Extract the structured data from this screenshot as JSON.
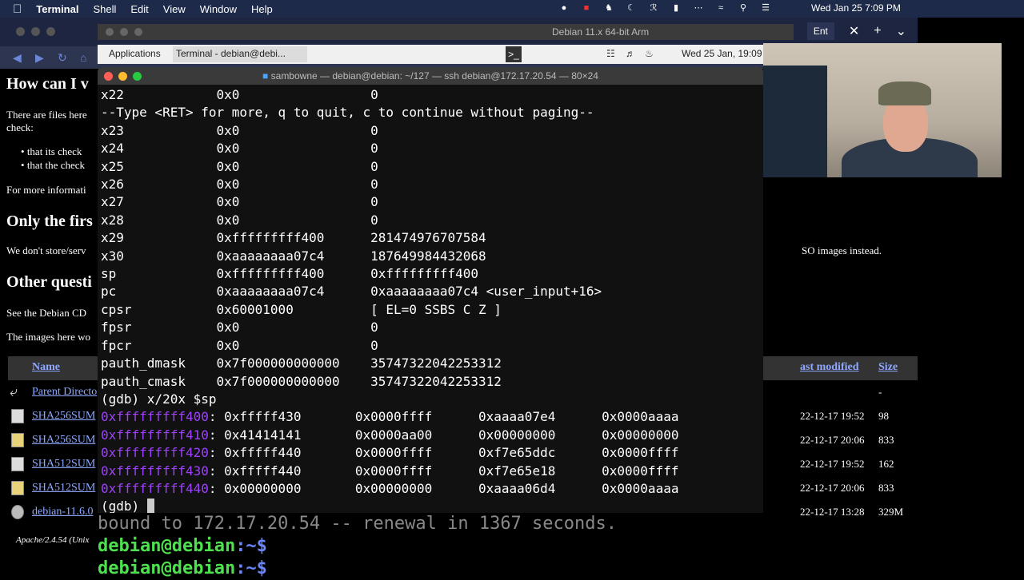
{
  "menubar": {
    "apple": "",
    "app": "Terminal",
    "items": [
      "Shell",
      "Edit",
      "View",
      "Window",
      "Help"
    ],
    "clock": "Wed Jan 25  7:09 PM"
  },
  "browser": {
    "tab_label": "Ent",
    "headings": [
      "How can I v",
      "Only the firs",
      "Other questi"
    ],
    "paragraphs": [
      "There are files here",
      "check:",
      "that its check",
      "that the check",
      "For more informati",
      "We don't store/serv",
      "SO images instead.",
      "See the Debian CD",
      "The images here wo",
      "Apache/2.4.54 (Unix"
    ],
    "table_headers": {
      "name": "Name",
      "modified": "ast modified",
      "size": "Size"
    },
    "rows": [
      {
        "name": "Parent Directo",
        "date": "",
        "size": "-"
      },
      {
        "name": "SHA256SUM",
        "date": "22-12-17 19:52",
        "size": "98"
      },
      {
        "name": "SHA256SUM",
        "date": "22-12-17 20:06",
        "size": "833"
      },
      {
        "name": "SHA512SUM",
        "date": "22-12-17 19:52",
        "size": "162"
      },
      {
        "name": "SHA512SUM",
        "date": "22-12-17 20:06",
        "size": "833"
      },
      {
        "name": "debian-11.6.0",
        "date": "22-12-17 13:28",
        "size": "329M"
      }
    ]
  },
  "vm": {
    "title": "Debian 11.x 64-bit Arm",
    "panel_apps": "Applications",
    "panel_task": "Terminal - debian@debi...",
    "panel_clock": "Wed 25 Jan, 19:09"
  },
  "terminal": {
    "title": "sambowne — debian@debian: ~/127 — ssh debian@172.17.20.54 — 80×24",
    "lines": [
      "x22            0x0                 0",
      "--Type <RET> for more, q to quit, c to continue without paging--",
      "x23            0x0                 0",
      "x24            0x0                 0",
      "x25            0x0                 0",
      "x26            0x0                 0",
      "x27            0x0                 0",
      "x28            0x0                 0",
      "x29            0xfffffffff400      281474976707584",
      "x30            0xaaaaaaaa07c4      187649984432068",
      "sp             0xfffffffff400      0xfffffffff400",
      "pc             0xaaaaaaaa07c4      0xaaaaaaaa07c4 <user_input+16>",
      "cpsr           0x60001000          [ EL=0 SSBS C Z ]",
      "fpsr           0x0                 0",
      "fpcr           0x0                 0",
      "pauth_dmask    0x7f000000000000    35747322042253312",
      "pauth_cmask    0x7f000000000000    35747322042253312",
      "(gdb) x/20x $sp"
    ],
    "memdump": [
      {
        "addr": "0xfffffffff400",
        "vals": ": 0xfffff430       0x0000ffff      0xaaaa07e4      0x0000aaaa"
      },
      {
        "addr": "0xfffffffff410",
        "vals": ": 0x41414141       0x0000aa00      0x00000000      0x00000000"
      },
      {
        "addr": "0xfffffffff420",
        "vals": ": 0xfffff440       0x0000ffff      0xf7e65ddc      0x0000ffff"
      },
      {
        "addr": "0xfffffffff430",
        "vals": ": 0xfffff440       0x0000ffff      0xf7e65e18      0x0000ffff"
      },
      {
        "addr": "0xfffffffff440",
        "vals": ": 0x00000000       0x00000000      0xaaaa06d4      0x0000aaaa"
      }
    ],
    "prompt": "(gdb) "
  },
  "under_terminal": {
    "line1": "bound to 172.17.20.54 -- renewal in 1367 seconds.",
    "user": "debian@debian",
    "path": ":~$"
  }
}
